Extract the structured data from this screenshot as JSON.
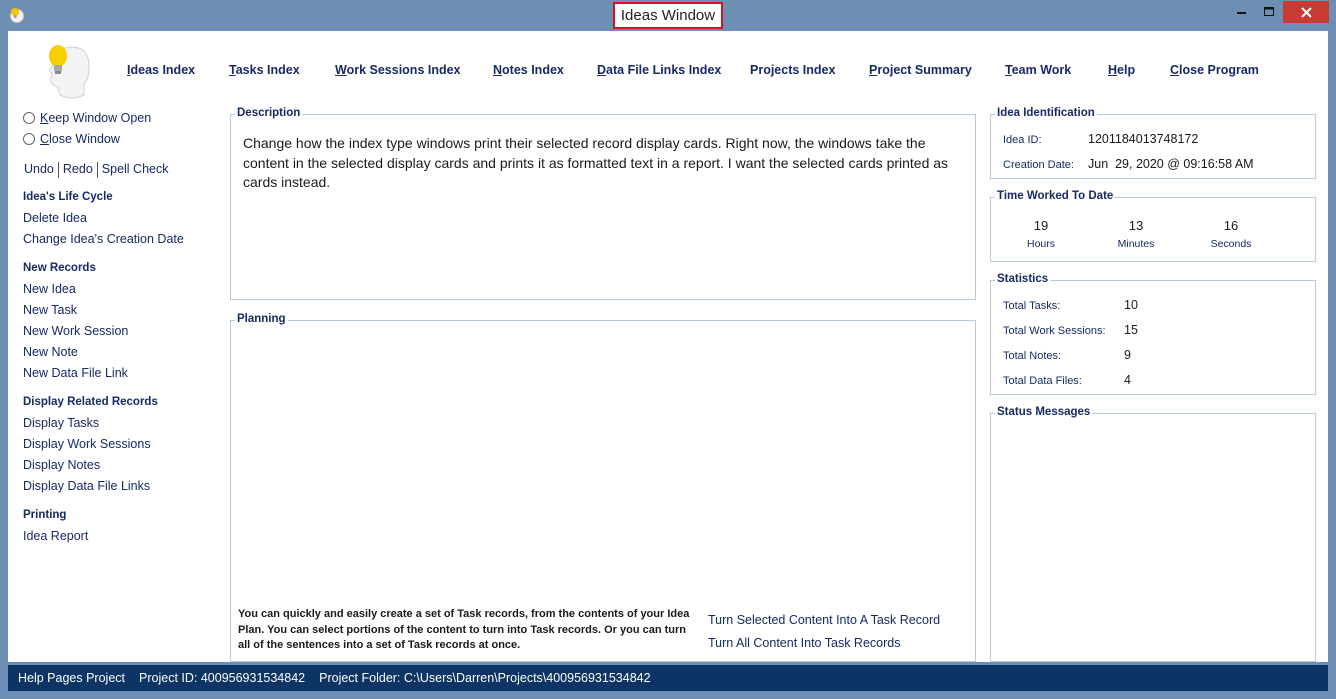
{
  "window": {
    "title": "Ideas Window",
    "minimize_glyph": "—",
    "maximize_glyph": "☐",
    "close_glyph": "✕"
  },
  "nav": {
    "items": [
      {
        "mn": "I",
        "rest": "deas Index"
      },
      {
        "mn": "T",
        "rest": "asks Index"
      },
      {
        "mn": "W",
        "rest": "ork Sessions Index"
      },
      {
        "mn": "N",
        "rest": "otes Index"
      },
      {
        "mn": "D",
        "rest": "ata File Links Index"
      },
      {
        "mn": "",
        "rest": "Projects Index"
      },
      {
        "mn": "P",
        "rest": "roject Summary"
      },
      {
        "mn": "T",
        "rest": "eam Work"
      },
      {
        "mn": "H",
        "rest": "elp"
      },
      {
        "mn": "C",
        "rest": "lose Program"
      }
    ]
  },
  "sidebar": {
    "keep_open": {
      "mn": "K",
      "rest": "eep Window Open"
    },
    "close_window": {
      "mn": "C",
      "rest": "lose Window"
    },
    "edit": {
      "undo": "Undo",
      "redo": "Redo",
      "spell": "Spell Check"
    },
    "life_cycle": {
      "heading": "Idea's Life Cycle",
      "items": [
        "Delete Idea",
        "Change Idea's Creation Date"
      ]
    },
    "new_records": {
      "heading": "New Records",
      "items": [
        "New Idea",
        "New Task",
        "New Work Session",
        "New Note",
        "New Data File Link"
      ]
    },
    "related": {
      "heading": "Display Related Records",
      "items": [
        "Display Tasks",
        "Display Work Sessions",
        "Display Notes",
        "Display Data File Links"
      ]
    },
    "printing": {
      "heading": "Printing",
      "items": [
        "Idea Report"
      ]
    }
  },
  "description": {
    "label": "Description",
    "text": "Change how the index type windows print their selected record display cards. Right now, the windows take the content in the selected display cards and prints it as formatted text in a report. I want the selected cards printed as cards instead."
  },
  "planning": {
    "label": "Planning",
    "hint": "You can quickly and easily create a set of Task records, from the contents of your Idea Plan. You can select portions of the content to turn into Task records. Or you can turn all of the sentences into a set of Task records at once.",
    "link_selected": "Turn Selected Content Into A Task Record",
    "link_all": "Turn All Content Into Task Records"
  },
  "identification": {
    "label": "Idea Identification",
    "id_label": "Idea ID:",
    "id_value": "1201184013748172",
    "date_label": "Creation Date:",
    "date_value": "Jun  29, 2020 @ 09:16:58 AM"
  },
  "time_worked": {
    "label": "Time Worked To Date",
    "hours": "19",
    "hours_label": "Hours",
    "minutes": "13",
    "minutes_label": "Minutes",
    "seconds": "16",
    "seconds_label": "Seconds"
  },
  "statistics": {
    "label": "Statistics",
    "rows": [
      {
        "label": "Total Tasks:",
        "value": "10"
      },
      {
        "label": "Total Work Sessions:",
        "value": "15"
      },
      {
        "label": "Total Notes:",
        "value": "9"
      },
      {
        "label": "Total Data Files:",
        "value": "4"
      }
    ]
  },
  "status_messages": {
    "label": "Status Messages"
  },
  "statusbar": {
    "project": "Help Pages Project",
    "project_id": "Project ID:  400956931534842",
    "project_folder": "Project Folder: C:\\Users\\Darren\\Projects\\400956931534842"
  },
  "colors": {
    "accent_text": "#172a63",
    "statusbar_bg": "#0c3464",
    "title_highlight": "#d9101e"
  }
}
